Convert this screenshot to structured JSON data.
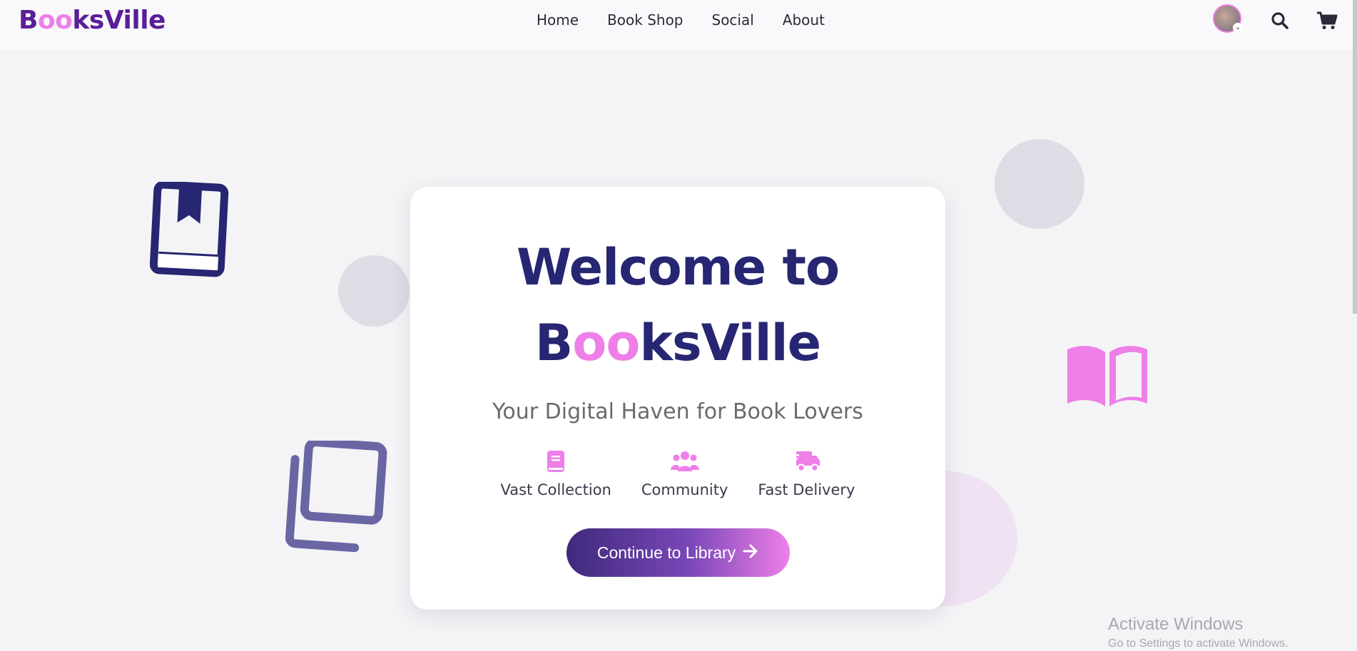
{
  "brand": {
    "parts": [
      "B",
      "oo",
      "ksVille"
    ],
    "colors": {
      "primary": "#5a1e96",
      "accent": "#ee7fe8",
      "heading": "#262672"
    }
  },
  "nav": {
    "items": [
      {
        "label": "Home"
      },
      {
        "label": "Book Shop"
      },
      {
        "label": "Social"
      },
      {
        "label": "About"
      }
    ]
  },
  "header_icons": {
    "avatar": "user-avatar",
    "search": "search-icon",
    "cart": "cart-icon"
  },
  "hero": {
    "title_line1": "Welcome to",
    "title_brand": {
      "b": "B",
      "oo": "oo",
      "rest": "ksVille"
    },
    "subtitle": "Your Digital Haven for Book Lovers",
    "features": [
      {
        "icon": "book-icon",
        "label": "Vast Collection"
      },
      {
        "icon": "users-icon",
        "label": "Community"
      },
      {
        "icon": "truck-icon",
        "label": "Fast Delivery"
      }
    ],
    "cta_label": "Continue to Library"
  },
  "watermark": {
    "line1": "Activate Windows",
    "line2": "Go to Settings to activate Windows."
  }
}
